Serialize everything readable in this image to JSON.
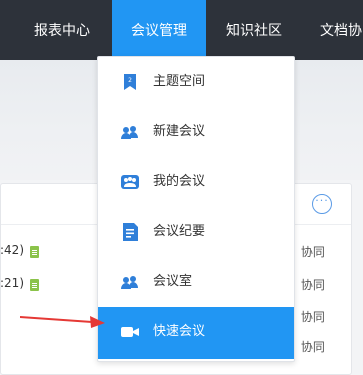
{
  "topnav": {
    "items": [
      {
        "label": "报表中心"
      },
      {
        "label": "会议管理",
        "active": true
      },
      {
        "label": "知识社区"
      },
      {
        "label": "文档协"
      }
    ]
  },
  "dropdown": {
    "items": [
      {
        "label": "主题空间",
        "icon": "theme-space-icon"
      },
      {
        "label": "新建会议",
        "icon": "new-meeting-icon"
      },
      {
        "label": "我的会议",
        "icon": "my-meeting-icon"
      },
      {
        "label": "会议纪要",
        "icon": "minutes-icon"
      },
      {
        "label": "会议室",
        "icon": "meeting-room-icon"
      },
      {
        "label": "快速会议",
        "icon": "video-camera-icon",
        "selected": true
      }
    ]
  },
  "background": {
    "more_label": "···",
    "rows": [
      {
        "text": ":42)"
      },
      {
        "text": ":21)"
      }
    ],
    "collab_label": "协同"
  },
  "colors": {
    "nav_bg": "#2d323a",
    "accent": "#2196f3",
    "annotation_arrow": "#e53935"
  }
}
